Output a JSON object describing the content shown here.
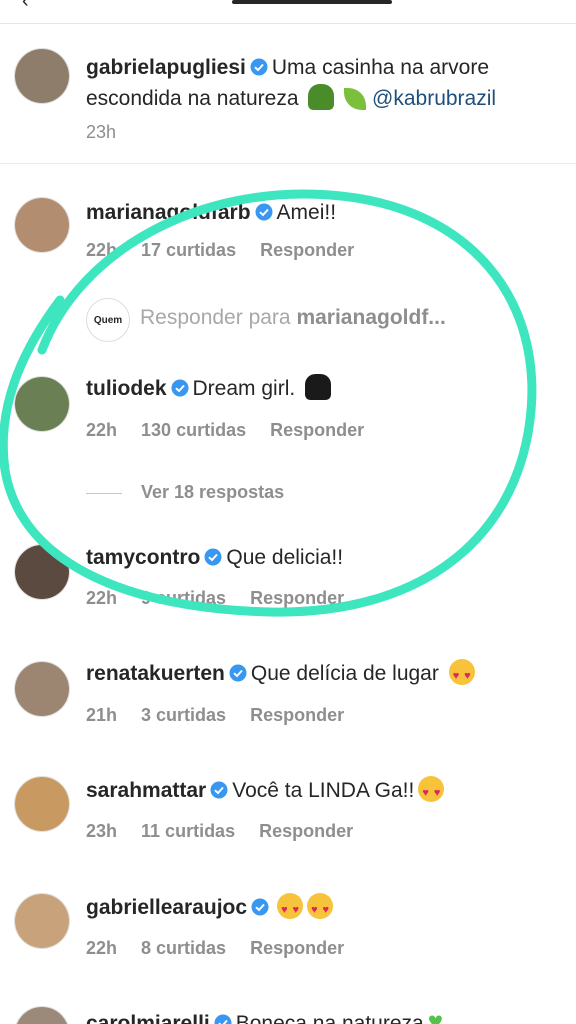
{
  "header": {
    "back_icon": "chevron-left-icon"
  },
  "caption": {
    "username": "gabrielapugliesi",
    "text_line1": "Uma casinha na arvore",
    "text_line2": "escondida na natureza",
    "mention": "@kabrubrazil",
    "time": "23h",
    "avatar_color": "#8f7d6c"
  },
  "comments": [
    {
      "username": "marianagoldfarb",
      "text": "Amei!!",
      "time": "22h",
      "likes": "17 curtidas",
      "reply": "Responder",
      "avatar_color": "#b38d70"
    },
    {
      "username": "tuliodek",
      "text": "Dream girl.",
      "time": "22h",
      "likes": "130 curtidas",
      "reply": "Responder",
      "avatar_color": "#6a7f54"
    },
    {
      "username": "tamycontro",
      "text": "Que delicia!!",
      "time": "22h",
      "likes": "9 curtidas",
      "reply": "Responder",
      "avatar_color": "#5b4a3f"
    },
    {
      "username": "renatakuerten",
      "text": "Que delícia de lugar",
      "time": "21h",
      "likes": "3 curtidas",
      "reply": "Responder",
      "avatar_color": "#9c8571"
    },
    {
      "username": "sarahmattar",
      "text": "Você ta LINDA Ga!!",
      "time": "23h",
      "likes": "11 curtidas",
      "reply": "Responder",
      "avatar_color": "#c89a62"
    },
    {
      "username": "gabriellearaujoc",
      "text": "",
      "time": "22h",
      "likes": "8 curtidas",
      "reply": "Responder",
      "avatar_color": "#c7a27a"
    },
    {
      "username": "carolmiarelli",
      "text": "Boneca na natureza",
      "avatar_color": "#9b8a7a"
    }
  ],
  "reply_input": {
    "badge": "Quem",
    "prefix": "Responder para",
    "target": "marianagoldf..."
  },
  "view_replies": "Ver 18 respostas",
  "annotation_color": "#3ee6c0",
  "verified_color": "#3897f0"
}
